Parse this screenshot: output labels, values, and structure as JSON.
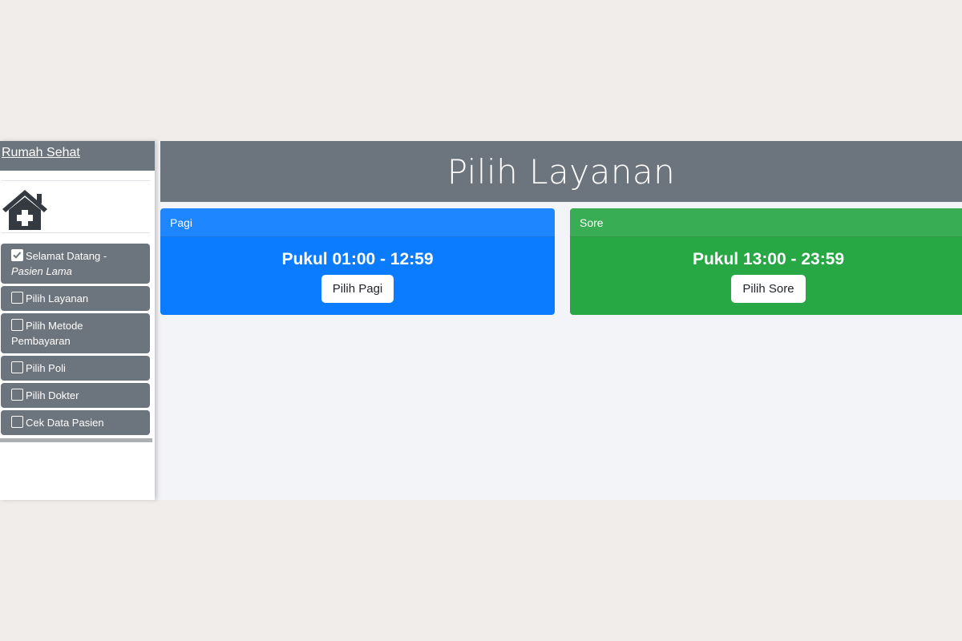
{
  "sidebar": {
    "brand": "Rumah Sehat",
    "logo_icon": "house-medical-icon",
    "steps": [
      {
        "label": "Selamat Datang - ",
        "label_em": "Pasien Lama",
        "checked": true
      },
      {
        "label": "Pilih Layanan",
        "checked": false
      },
      {
        "label": "Pilih Metode Pembayaran",
        "checked": false
      },
      {
        "label": "Pilih Poli",
        "checked": false
      },
      {
        "label": "Pilih Dokter",
        "checked": false
      },
      {
        "label": "Cek Data Pasien",
        "checked": false
      }
    ]
  },
  "header": {
    "title": "Pilih Layanan"
  },
  "cards": [
    {
      "header": "Pagi",
      "time": "Pukul 01:00 - 12:59",
      "button": "Pilih Pagi",
      "color": "#0b7cff"
    },
    {
      "header": "Sore",
      "time": "Pukul 13:00 - 23:59",
      "button": "Pilih Sore",
      "color": "#28a745"
    }
  ],
  "colors": {
    "bar": "#6c757d",
    "background": "#f3f4f8"
  }
}
